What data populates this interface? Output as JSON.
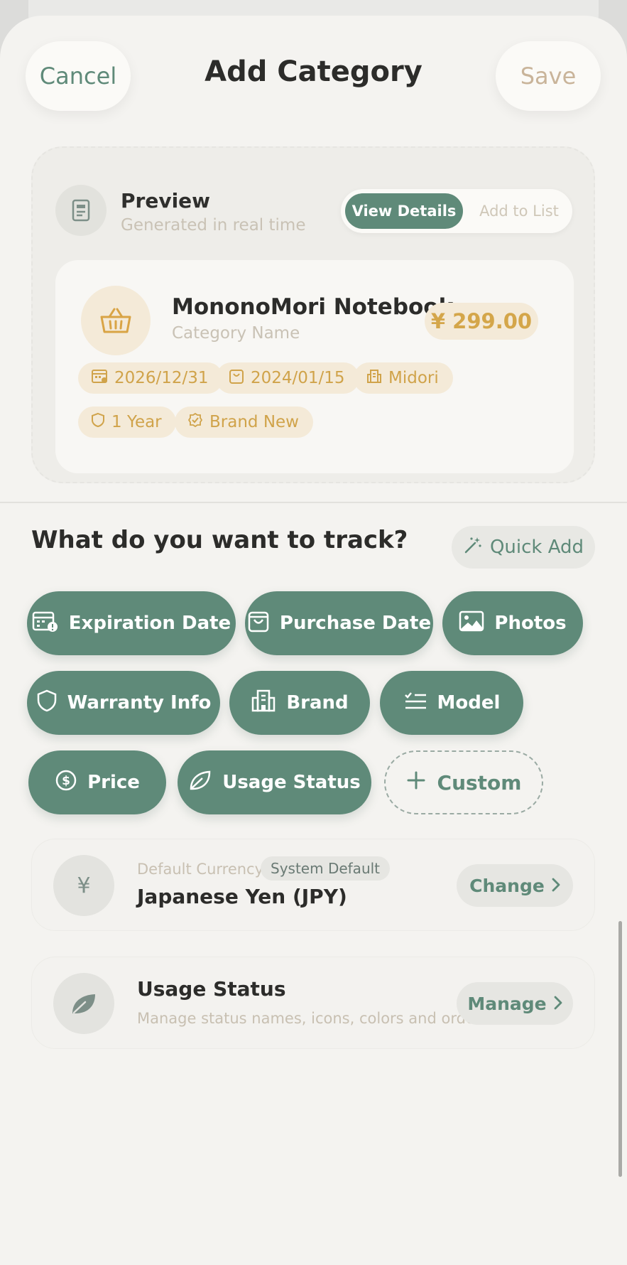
{
  "header": {
    "cancel_label": "Cancel",
    "title": "Add Category",
    "save_label": "Save"
  },
  "preview": {
    "title": "Preview",
    "subtitle": "Generated in real time",
    "toggle": {
      "active": "View Details",
      "inactive": "Add to List"
    },
    "item": {
      "name": "MononoMori Notebook",
      "category_placeholder": "Category Name",
      "price": "¥ 299.00",
      "tags": [
        {
          "icon": "calendar-icon",
          "label": "2026/12/31"
        },
        {
          "icon": "shopping-bag-icon",
          "label": "2024/01/15"
        },
        {
          "icon": "building-icon",
          "label": "Midori"
        },
        {
          "icon": "shield-icon",
          "label": "1 Year"
        },
        {
          "icon": "badge-check-icon",
          "label": "Brand New"
        }
      ]
    }
  },
  "track": {
    "heading": "What do you want to track?",
    "quick_add_label": "Quick Add",
    "chips": [
      {
        "icon": "calendar-alert-icon",
        "label": "Expiration Date"
      },
      {
        "icon": "shopping-bag-icon",
        "label": "Purchase Date"
      },
      {
        "icon": "image-icon",
        "label": "Photos"
      },
      {
        "icon": "shield-icon",
        "label": "Warranty Info"
      },
      {
        "icon": "building-icon",
        "label": "Brand"
      },
      {
        "icon": "checklist-icon",
        "label": "Model"
      },
      {
        "icon": "dollar-circle-icon",
        "label": "Price"
      },
      {
        "icon": "leaf-icon",
        "label": "Usage Status"
      }
    ],
    "custom_label": "Custom"
  },
  "currency_row": {
    "small_label": "Default Currency",
    "badge": "System Default",
    "value": "Japanese Yen (JPY)",
    "button": "Change",
    "icon_glyph": "¥"
  },
  "usage_row": {
    "title": "Usage Status",
    "subtitle": "Manage status names, icons, colors and order",
    "button": "Manage"
  },
  "colors": {
    "accent": "#5f8a79",
    "gold": "#d4a64a",
    "background": "#f4f3f0"
  }
}
